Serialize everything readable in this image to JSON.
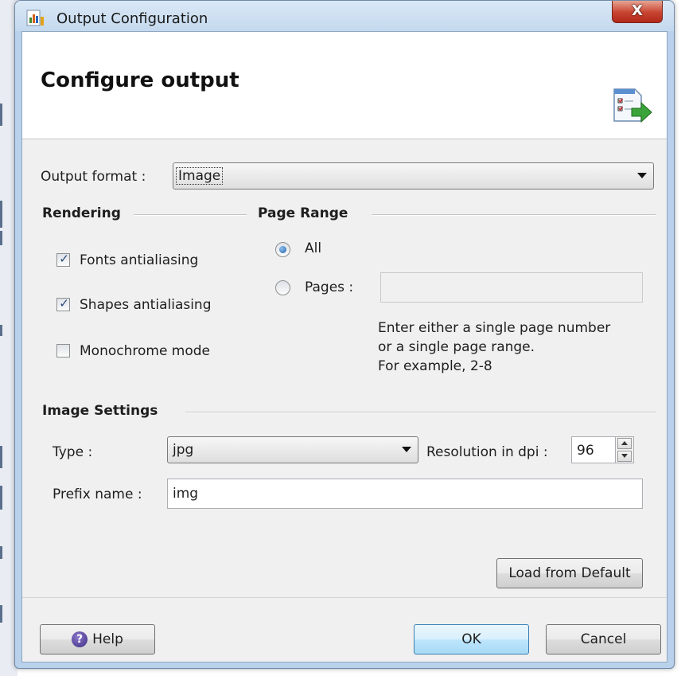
{
  "window": {
    "title": "Output Configuration",
    "close_glyph": "X"
  },
  "header": {
    "title": "Configure output",
    "icon": "checklist-export-icon"
  },
  "output_format": {
    "label": "Output format :",
    "value": "Image"
  },
  "rendering": {
    "title": "Rendering",
    "options": [
      {
        "label": "Fonts antialiasing",
        "checked": true
      },
      {
        "label": "Shapes antialiasing",
        "checked": true
      },
      {
        "label": "Monochrome mode",
        "checked": false
      }
    ]
  },
  "page_range": {
    "title": "Page Range",
    "all_label": "All",
    "pages_label": "Pages :",
    "selected": "All",
    "pages_value": "",
    "hint_lines": [
      "Enter either a single page number",
      "or a single page range.",
      "For example, 2-8"
    ]
  },
  "image_settings": {
    "title": "Image Settings",
    "type_label": "Type :",
    "type_value": "jpg",
    "resolution_label": "Resolution in dpi :",
    "resolution_value": "96",
    "prefix_label": "Prefix name :",
    "prefix_value": "img"
  },
  "buttons": {
    "load_default": "Load from Default",
    "help": "Help",
    "ok": "OK",
    "cancel": "Cancel"
  },
  "colors": {
    "titlebar": "#c4d9ee",
    "close": "#c7432f",
    "dialog_bg": "#f0f0f0",
    "ok_button": "#bee6fd"
  }
}
